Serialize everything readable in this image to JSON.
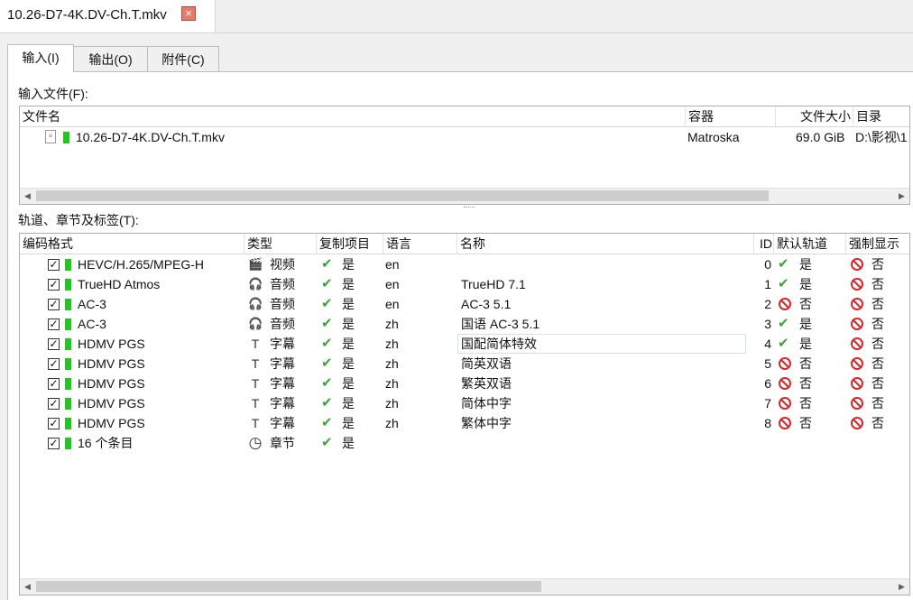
{
  "document_tab": {
    "title": "10.26-D7-4K.DV-Ch.T.mkv",
    "close_icon": "close-icon"
  },
  "tabs": [
    "输入(I)",
    "输出(O)",
    "附件(C)"
  ],
  "input_files": {
    "label": "输入文件(F):",
    "columns": [
      "文件名",
      "容器",
      "文件大小",
      "目录"
    ],
    "rows": [
      {
        "name": "10.26-D7-4K.DV-Ch.T.mkv",
        "container": "Matroska",
        "size": "69.0 GiB",
        "dir": "D:\\影视\\1"
      }
    ]
  },
  "tracks": {
    "label": "轨道、章节及标签(T):",
    "columns": [
      "编码格式",
      "类型",
      "复制项目",
      "语言",
      "名称",
      "ID",
      "默认轨道",
      "强制显示"
    ],
    "rows": [
      {
        "codec": "HEVC/H.265/MPEG-H",
        "type": "视频",
        "type_icon": "video-icon",
        "copy": "是",
        "lang": "en",
        "name": "",
        "id": "0",
        "default": "是",
        "default_yes": true,
        "forced": "否"
      },
      {
        "codec": "TrueHD Atmos",
        "type": "音频",
        "type_icon": "headphones-icon",
        "copy": "是",
        "lang": "en",
        "name": "TrueHD 7.1",
        "id": "1",
        "default": "是",
        "default_yes": true,
        "forced": "否"
      },
      {
        "codec": "AC-3",
        "type": "音频",
        "type_icon": "headphones-icon",
        "copy": "是",
        "lang": "en",
        "name": "AC-3 5.1",
        "id": "2",
        "default": "否",
        "default_yes": false,
        "forced": "否"
      },
      {
        "codec": "AC-3",
        "type": "音频",
        "type_icon": "headphones-icon",
        "copy": "是",
        "lang": "zh",
        "name": "国语 AC-3 5.1",
        "id": "3",
        "default": "是",
        "default_yes": true,
        "forced": "否"
      },
      {
        "codec": "HDMV PGS",
        "type": "字幕",
        "type_icon": "subtitle-icon",
        "copy": "是",
        "lang": "zh",
        "name": "国配简体特效",
        "id": "4",
        "default": "是",
        "default_yes": true,
        "forced": "否",
        "editing": true
      },
      {
        "codec": "HDMV PGS",
        "type": "字幕",
        "type_icon": "subtitle-icon",
        "copy": "是",
        "lang": "zh",
        "name": "简英双语",
        "id": "5",
        "default": "否",
        "default_yes": false,
        "forced": "否"
      },
      {
        "codec": "HDMV PGS",
        "type": "字幕",
        "type_icon": "subtitle-icon",
        "copy": "是",
        "lang": "zh",
        "name": "繁英双语",
        "id": "6",
        "default": "否",
        "default_yes": false,
        "forced": "否"
      },
      {
        "codec": "HDMV PGS",
        "type": "字幕",
        "type_icon": "subtitle-icon",
        "copy": "是",
        "lang": "zh",
        "name": "简体中字",
        "id": "7",
        "default": "否",
        "default_yes": false,
        "forced": "否"
      },
      {
        "codec": "HDMV PGS",
        "type": "字幕",
        "type_icon": "subtitle-icon",
        "copy": "是",
        "lang": "zh",
        "name": "繁体中字",
        "id": "8",
        "default": "否",
        "default_yes": false,
        "forced": "否"
      },
      {
        "codec": "16 个条目",
        "type": "章节",
        "type_icon": "clock-icon",
        "copy": "是",
        "lang": "",
        "name": "",
        "id": "",
        "default": "",
        "default_yes": null,
        "forced": ""
      }
    ]
  },
  "colors": {
    "green_status": "#22c522",
    "tick": "#3aa63a",
    "no": "#d9262a"
  }
}
